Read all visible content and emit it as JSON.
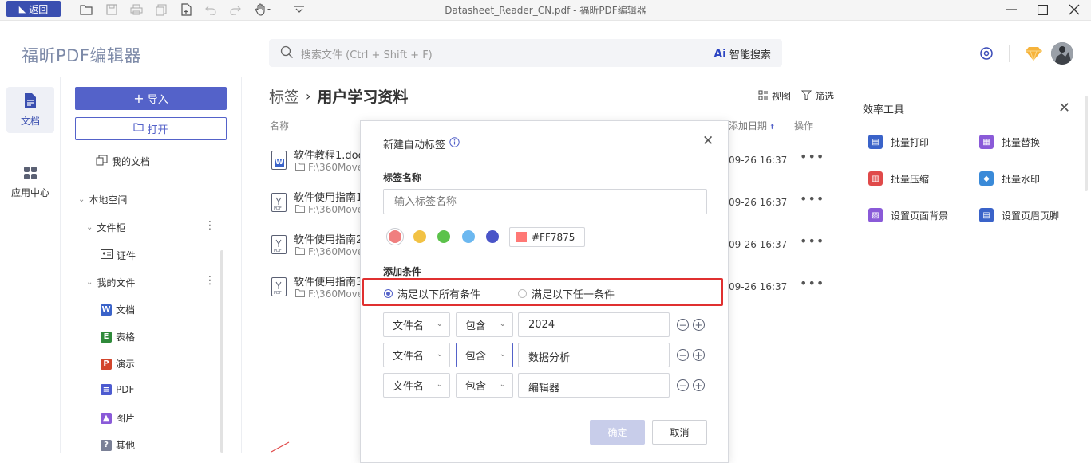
{
  "titlebar": {
    "back_label": "返回",
    "window_title": "Datasheet_Reader_CN.pdf - 福昕PDF编辑器"
  },
  "header": {
    "logo": "福昕PDF编辑器",
    "search_placeholder": "搜索文件 (Ctrl + Shift + F)",
    "ai_search_label": "智能搜索"
  },
  "rail": {
    "items": [
      {
        "label": "文档",
        "icon": "document-icon"
      },
      {
        "label": "应用中心",
        "icon": "apps-grid-icon"
      }
    ]
  },
  "nav": {
    "import_label": "导入",
    "open_label": "打开",
    "my_docs": "我的文档",
    "local_space": "本地空间",
    "cabinet": "文件柜",
    "certificate": "证件",
    "my_files": "我的文件",
    "types": [
      {
        "label": "文档",
        "icon": "W",
        "color": "#3a63c9"
      },
      {
        "label": "表格",
        "icon": "E",
        "color": "#2f8a3a"
      },
      {
        "label": "演示",
        "icon": "P",
        "color": "#d2452c"
      },
      {
        "label": "PDF",
        "icon": "≡",
        "color": "#4d5bd0"
      },
      {
        "label": "图片",
        "icon": "▲",
        "color": "#8a5ad8"
      },
      {
        "label": "其他",
        "icon": "?",
        "color": "#7a8096"
      }
    ]
  },
  "main": {
    "crumb_root": "标签",
    "crumb_current": "用户学习资料",
    "view_label": "视图",
    "filter_label": "筛选",
    "columns": {
      "name": "名称",
      "date": "添加日期",
      "action": "操作"
    },
    "files": [
      {
        "name": "软件教程1.doc",
        "path": "F:\\360Move",
        "date": "09-26 16:37",
        "type": "W"
      },
      {
        "name": "软件使用指南1",
        "path": "F:\\360Move",
        "date": "09-26 16:37",
        "type": "PDF"
      },
      {
        "name": "软件使用指南2",
        "path": "F:\\360Move",
        "date": "09-26 16:37",
        "type": "PDF"
      },
      {
        "name": "软件使用指南3",
        "path": "F:\\360Move",
        "date": "09-26 16:37",
        "type": "PDF"
      }
    ]
  },
  "tools": {
    "title": "效率工具",
    "items": [
      {
        "label": "批量打印",
        "icon": "printer-icon",
        "color": "#3a63c9"
      },
      {
        "label": "批量替换",
        "icon": "replace-icon",
        "color": "#8a5ad8"
      },
      {
        "label": "批量压缩",
        "icon": "compress-icon",
        "color": "#e04a4a"
      },
      {
        "label": "批量水印",
        "icon": "watermark-icon",
        "color": "#3a8ad8"
      },
      {
        "label": "设置页面背景",
        "icon": "background-icon",
        "color": "#8a5ad8"
      },
      {
        "label": "设置页眉页脚",
        "icon": "header-footer-icon",
        "color": "#3a63c9"
      }
    ]
  },
  "dialog": {
    "title": "新建自动标签",
    "name_label": "标签名称",
    "name_placeholder": "输入标签名称",
    "colors": [
      "#f07f7f",
      "#f2c244",
      "#5cc24b",
      "#6cb8f0",
      "#4a55c8"
    ],
    "hex_value": "#FF7875",
    "hex_color": "#ff7875",
    "condition_label": "添加条件",
    "match_all": "满足以下所有条件",
    "match_any": "满足以下任一条件",
    "rules": [
      {
        "field": "文件名",
        "op": "包含",
        "value": "2024"
      },
      {
        "field": "文件名",
        "op": "包含",
        "value": "数据分析"
      },
      {
        "field": "文件名",
        "op": "包含",
        "value": "编辑器"
      }
    ],
    "ok_label": "确定",
    "cancel_label": "取消"
  }
}
